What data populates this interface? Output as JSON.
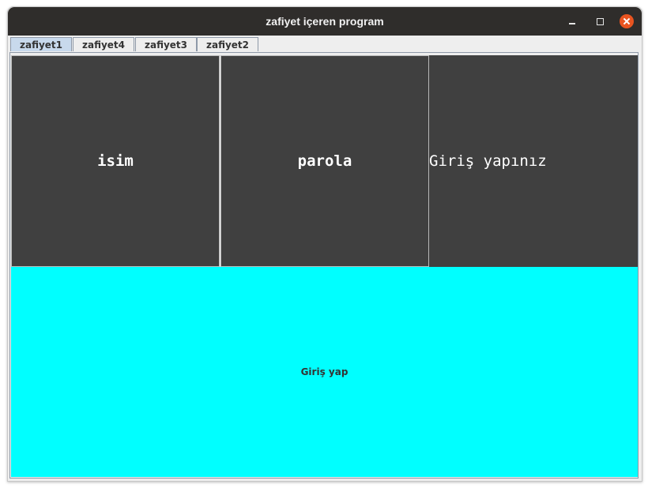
{
  "window": {
    "title": "zafiyet içeren program"
  },
  "tabs": [
    {
      "label": "zafiyet1",
      "active": true
    },
    {
      "label": "zafiyet4",
      "active": false
    },
    {
      "label": "zafiyet3",
      "active": false
    },
    {
      "label": "zafiyet2",
      "active": false
    }
  ],
  "form": {
    "name_label": "isim",
    "password_label": "parola",
    "status_text": "Giriş yapınız",
    "login_button": "Giriş yap"
  },
  "colors": {
    "titlebar": "#2f2d2b",
    "panel": "#404040",
    "login_button": "#00ffff",
    "active_tab": "#c8d9ec",
    "close_button": "#e95420"
  },
  "icons": {
    "minimize": "minimize-icon",
    "maximize": "maximize-icon",
    "close": "close-icon"
  }
}
